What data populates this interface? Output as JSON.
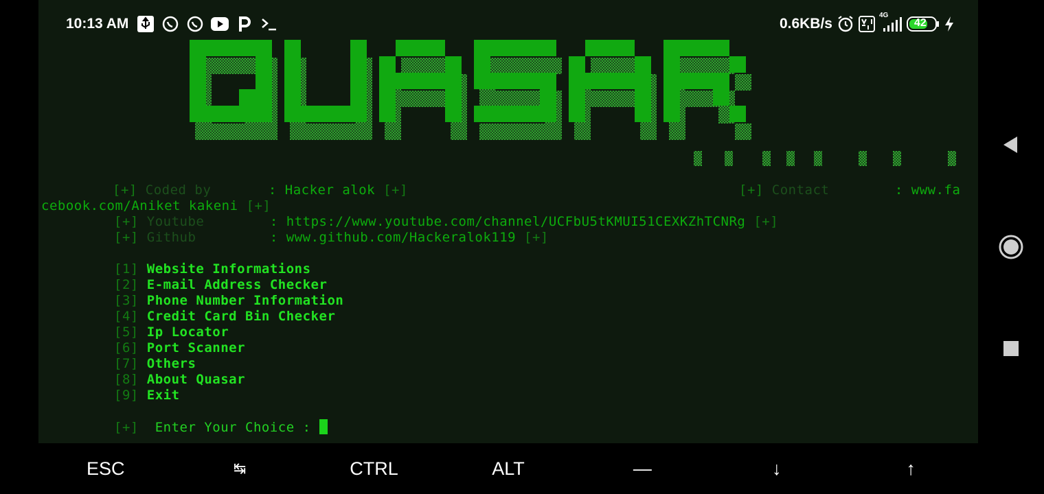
{
  "status_bar": {
    "time": "10:13 AM",
    "left_icons": [
      "usb-icon",
      "whatsapp-icon",
      "whatsapp-icon",
      "youtube-icon",
      "paytm-icon",
      "terminal-icon"
    ],
    "speed": "0.6KB/s",
    "right_icons": [
      "alarm-icon",
      "volte-icon",
      "signal-icon",
      "battery-icon",
      "charging-icon"
    ],
    "network": "4G",
    "battery": "42"
  },
  "banner": {
    "text": "QUASAR"
  },
  "info": {
    "bracket": "[+]",
    "coded_label": "Coded by",
    "coded_value": "Hacker alok",
    "contact_label": "Contact",
    "contact_value_a": "www.fa",
    "contact_value_b": "cebook.com/Aniket kakeni",
    "youtube_label": "Youtube",
    "youtube_value": "https://www.youtube.com/channel/UCFbU5tKMUI51CEXKZhTCNRg",
    "github_label": "Github",
    "github_value": "www.github.com/Hackeralok119",
    "colon": ":"
  },
  "menu": [
    {
      "num": "[1]",
      "label": "Website Informations"
    },
    {
      "num": "[2]",
      "label": "E-mail Address Checker"
    },
    {
      "num": "[3]",
      "label": "Phone Number Information"
    },
    {
      "num": "[4]",
      "label": "Credit Card Bin Checker"
    },
    {
      "num": "[5]",
      "label": "Ip Locator"
    },
    {
      "num": "[6]",
      "label": "Port Scanner"
    },
    {
      "num": "[7]",
      "label": "Others"
    },
    {
      "num": "[8]",
      "label": "About Quasar"
    },
    {
      "num": "[9]",
      "label": "Exit"
    }
  ],
  "prompt": {
    "bracket": "[+]",
    "text": "Enter Your Choice :"
  },
  "extra_keys": [
    "ESC",
    "↹",
    "CTRL",
    "ALT",
    "—",
    "↓",
    "↑"
  ],
  "nav": [
    "back-icon",
    "home-icon",
    "recents-icon"
  ],
  "colors": {
    "terminal_bg": "#0e1a0e",
    "accent_green": "#22e322",
    "dim_green": "#137b13"
  }
}
